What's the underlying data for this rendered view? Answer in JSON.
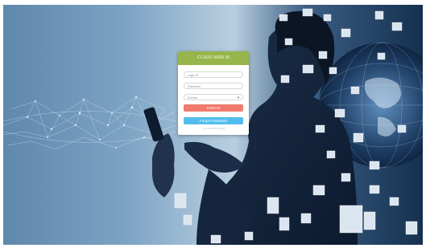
{
  "login_card": {
    "title": "CLOUD SIGN IN",
    "login_placeholder": "Login ID",
    "password_placeholder": "Password",
    "domain_value": "Domain",
    "signin_label": "SIGN IN",
    "forgot_label": "Forgot Password",
    "footer_text": "( 1 ) 2 3 4 5 6 7 8 9 0"
  },
  "colors": {
    "header": "#96b54a",
    "signin": "#ef7a6d",
    "forgot": "#52bdec"
  }
}
